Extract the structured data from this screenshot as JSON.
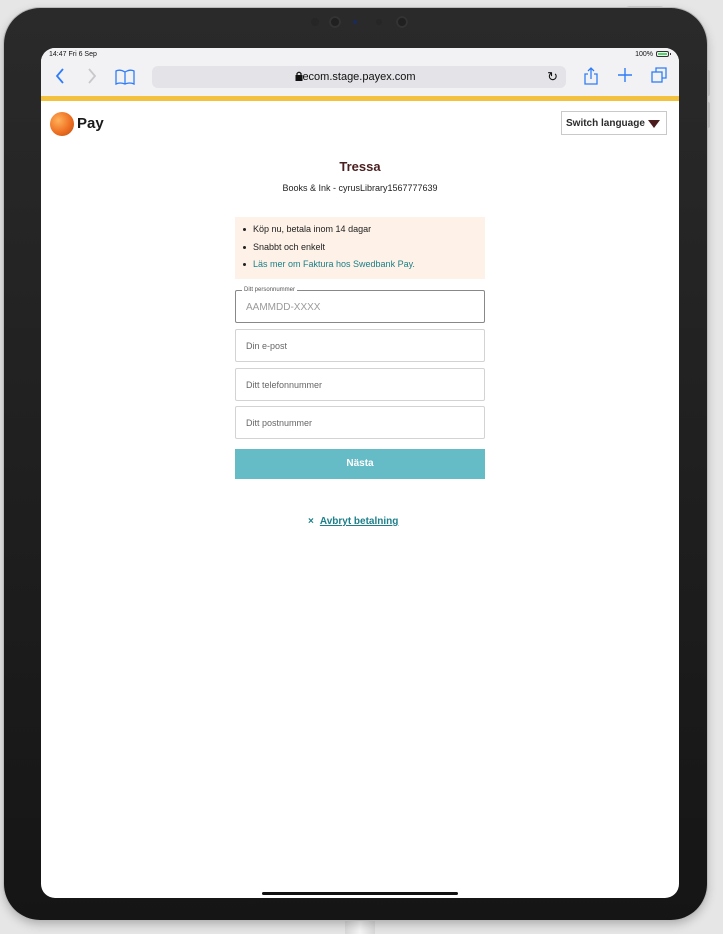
{
  "status": {
    "time": "14:47  Fri 6 Sep",
    "battery": "100%"
  },
  "browser": {
    "url": "ecom.stage.payex.com"
  },
  "header": {
    "brand": "Pay",
    "language_button": "Switch language"
  },
  "merchant": {
    "name": "Tressa",
    "subtitle": "Books & Ink - cyrusLibrary1567777639"
  },
  "info": {
    "bullets": [
      "Köp nu, betala inom 14 dagar",
      "Snabbt och enkelt"
    ],
    "link": "Läs mer om Faktura hos Swedbank Pay."
  },
  "form": {
    "ssn_label": "Ditt personnummer",
    "ssn_placeholder": "AAMMDD-XXXX",
    "email_placeholder": "Din e-post",
    "phone_placeholder": "Ditt telefonnummer",
    "postal_placeholder": "Ditt postnummer",
    "next_label": "Nästa"
  },
  "cancel": {
    "symbol": "×",
    "label": "Avbryt betalning"
  },
  "colors": {
    "accent_bar": "#f2c13d",
    "button": "#66bcc6",
    "link": "#1d7f8a",
    "info_bg": "#fdf1e8"
  }
}
